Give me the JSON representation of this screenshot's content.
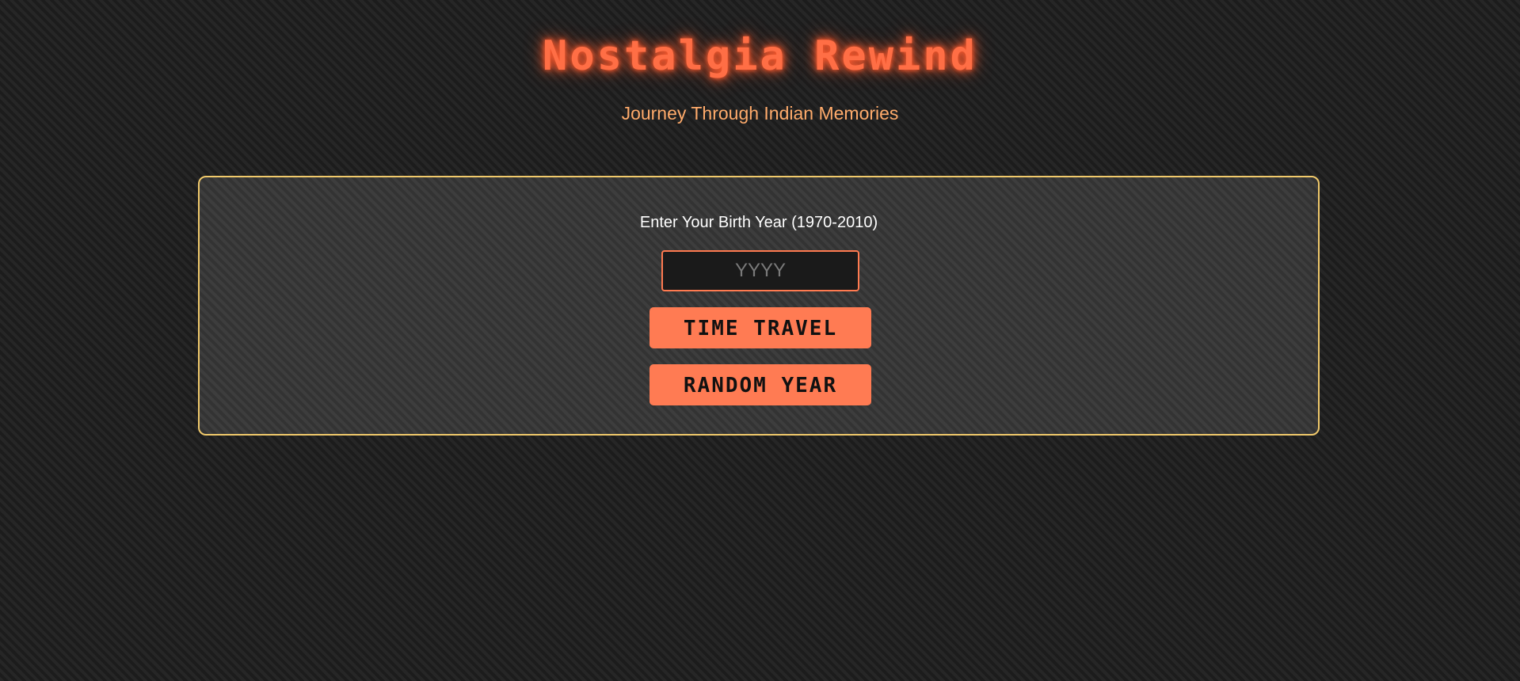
{
  "header": {
    "title": "Nostalgia Rewind",
    "subtitle": "Journey Through Indian Memories"
  },
  "form": {
    "label": "Enter Your Birth Year (1970-2010)",
    "year_input": {
      "placeholder": "YYYY",
      "value": ""
    },
    "time_travel_label": "TIME TRAVEL",
    "random_year_label": "RANDOM YEAR"
  },
  "colors": {
    "background": "#1f1f1f",
    "accent": "#ff7b53",
    "title_glow": "#ff5a2e",
    "subtitle": "#ffab6b",
    "panel_border": "#f0c96b"
  }
}
